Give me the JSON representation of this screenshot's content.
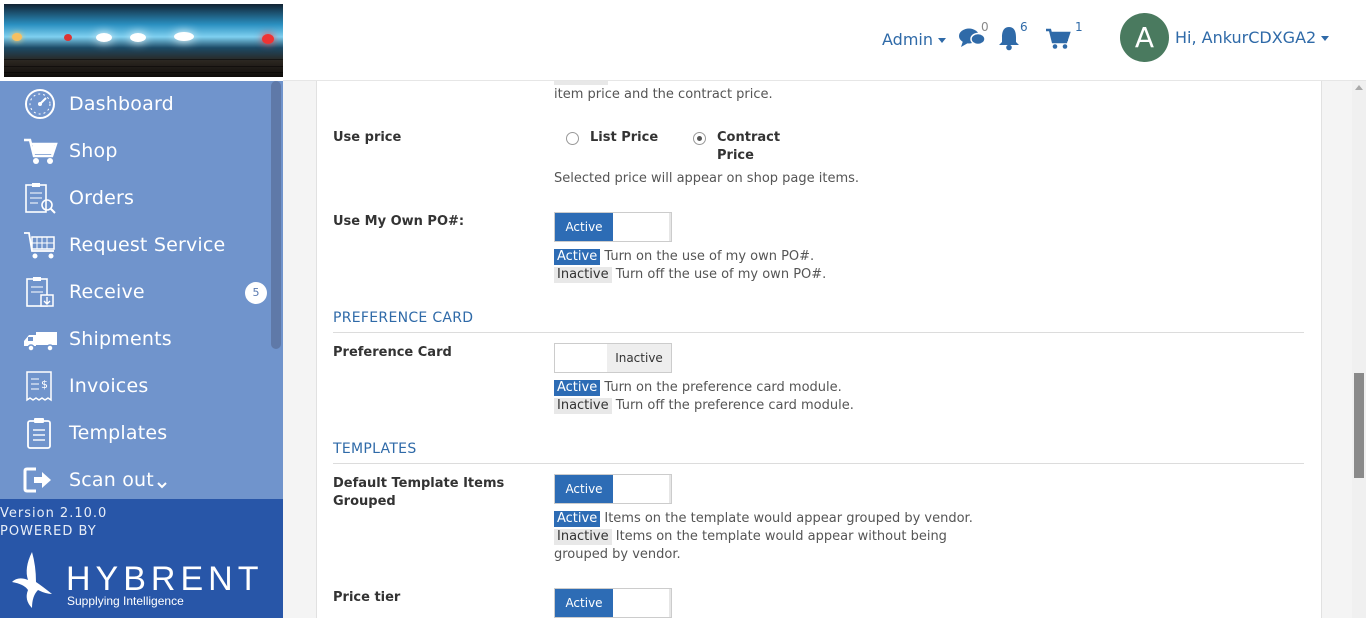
{
  "header": {
    "admin_label": "Admin",
    "messages_count": "0",
    "notifications_count": "6",
    "cart_count": "1",
    "avatar_letter": "A",
    "greeting": "Hi, AnkurCDXGA2"
  },
  "sidebar": {
    "items": [
      {
        "label": "Dashboard",
        "icon": "dashboard-icon"
      },
      {
        "label": "Shop",
        "icon": "cart-icon"
      },
      {
        "label": "Orders",
        "icon": "orders-icon"
      },
      {
        "label": "Request Service",
        "icon": "request-service-icon"
      },
      {
        "label": "Receive",
        "icon": "receive-icon",
        "badge": "5"
      },
      {
        "label": "Shipments",
        "icon": "truck-icon"
      },
      {
        "label": "Invoices",
        "icon": "invoice-icon"
      },
      {
        "label": "Templates",
        "icon": "templates-icon"
      },
      {
        "label": "Scan out",
        "icon": "scan-out-icon"
      }
    ],
    "version": "Version 2.10.0",
    "powered_by": "POWERED BY",
    "brand": "HYBRENT",
    "tagline": "Supplying Intelligence"
  },
  "settings": {
    "top_help_tail": "item price and the contract price.",
    "use_price": {
      "label": "Use price",
      "options": [
        "List Price",
        "Contract",
        "Price"
      ],
      "selected": "Contract Price",
      "help": "Selected price will appear on shop page items."
    },
    "own_po": {
      "label": "Use My Own PO#:",
      "state": "Active",
      "active_tag": "Active",
      "active_help": "Turn on the use of my own PO#.",
      "inactive_tag": "Inactive",
      "inactive_help": "Turn off the use of my own PO#."
    },
    "preference_section": "PREFERENCE CARD",
    "preference_card": {
      "label": "Preference Card",
      "state": "Inactive",
      "active_tag": "Active",
      "active_help": "Turn on the preference card module.",
      "inactive_tag": "Inactive",
      "inactive_help": "Turn off the preference card module."
    },
    "templates_section": "TEMPLATES",
    "template_grouped": {
      "label_line1": "Default Template Items",
      "label_line2": "Grouped",
      "state": "Active",
      "active_tag": "Active",
      "active_help": "Items on the template would appear grouped by vendor.",
      "inactive_tag": "Inactive",
      "inactive_help": "Items on the template would appear without being",
      "inactive_help2": "grouped by vendor."
    },
    "price_tier": {
      "label": "Price tier",
      "state": "Active"
    }
  },
  "colors": {
    "sidebar": "#7094cc",
    "sidebar_footer": "#2856a8",
    "accent": "#2d6cb5",
    "link": "#2f6aa8"
  }
}
